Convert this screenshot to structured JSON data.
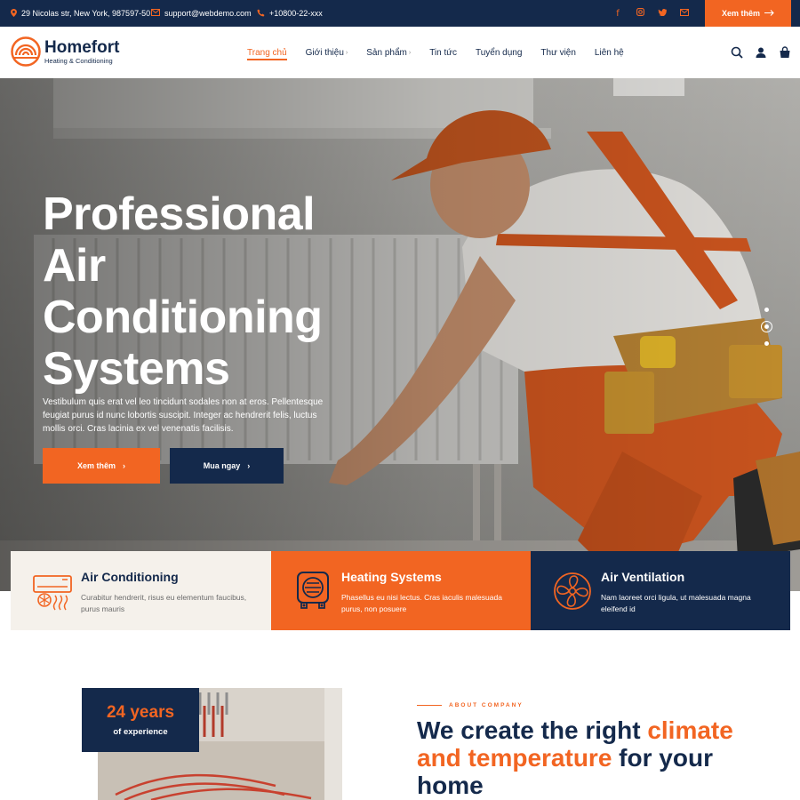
{
  "topbar": {
    "address": "29 Nicolas str, New York, 987597-50",
    "email": "support@webdemo.com",
    "phone": "+10800-22-xxx",
    "socials": [
      "facebook-icon",
      "instagram-icon",
      "twitter-icon",
      "mail-icon"
    ],
    "cta_label": "Xem thêm"
  },
  "brand": {
    "name": "Homefort",
    "tagline": "Heating & Conditioning"
  },
  "nav": {
    "items": [
      {
        "label": "Trang chủ",
        "active": true,
        "has_dropdown": false
      },
      {
        "label": "Giới thiệu",
        "active": false,
        "has_dropdown": true
      },
      {
        "label": "Sản phẩm",
        "active": false,
        "has_dropdown": true
      },
      {
        "label": "Tin tức",
        "active": false,
        "has_dropdown": false
      },
      {
        "label": "Tuyển dụng",
        "active": false,
        "has_dropdown": false
      },
      {
        "label": "Thư viện",
        "active": false,
        "has_dropdown": false
      },
      {
        "label": "Liên hệ",
        "active": false,
        "has_dropdown": false
      }
    ]
  },
  "hero": {
    "title_lines": [
      "Professional",
      "Air",
      "Conditioning",
      "Systems"
    ],
    "text": "Vestibulum quis erat vel leo tincidunt sodales non at eros. Pellentesque feugiat purus id nunc lobortis suscipit. Integer ac hendrerit felis, luctus mollis orci. Cras lacinia ex vel venenatis facilisis.",
    "primary_button": "Xem thêm",
    "secondary_button": "Mua ngay",
    "slides": 3,
    "active_slide": 2
  },
  "services": [
    {
      "title": "Air Conditioning",
      "desc": "Curabitur hendrerit, risus eu elementum faucibus, purus mauris",
      "icon": "air-conditioner-icon"
    },
    {
      "title": "Heating Systems",
      "desc": "Phasellus eu nisi lectus. Cras iaculis malesuada purus, non posuere",
      "icon": "heater-icon"
    },
    {
      "title": "Air Ventilation",
      "desc": "Nam laoreet orci ligula, ut malesuada magna eleifend id",
      "icon": "fan-icon"
    }
  ],
  "about": {
    "experience_number": "24 years",
    "experience_label": "of experience",
    "tag": "ABOUT COMPANY",
    "heading_1": "We create the right ",
    "heading_hl_1": "climate",
    "heading_hl_2": "and temperature",
    "heading_2": " for your",
    "heading_3": "home"
  },
  "colors": {
    "navy": "#14294b",
    "orange": "#f26522",
    "cream": "#f5f1eb"
  }
}
